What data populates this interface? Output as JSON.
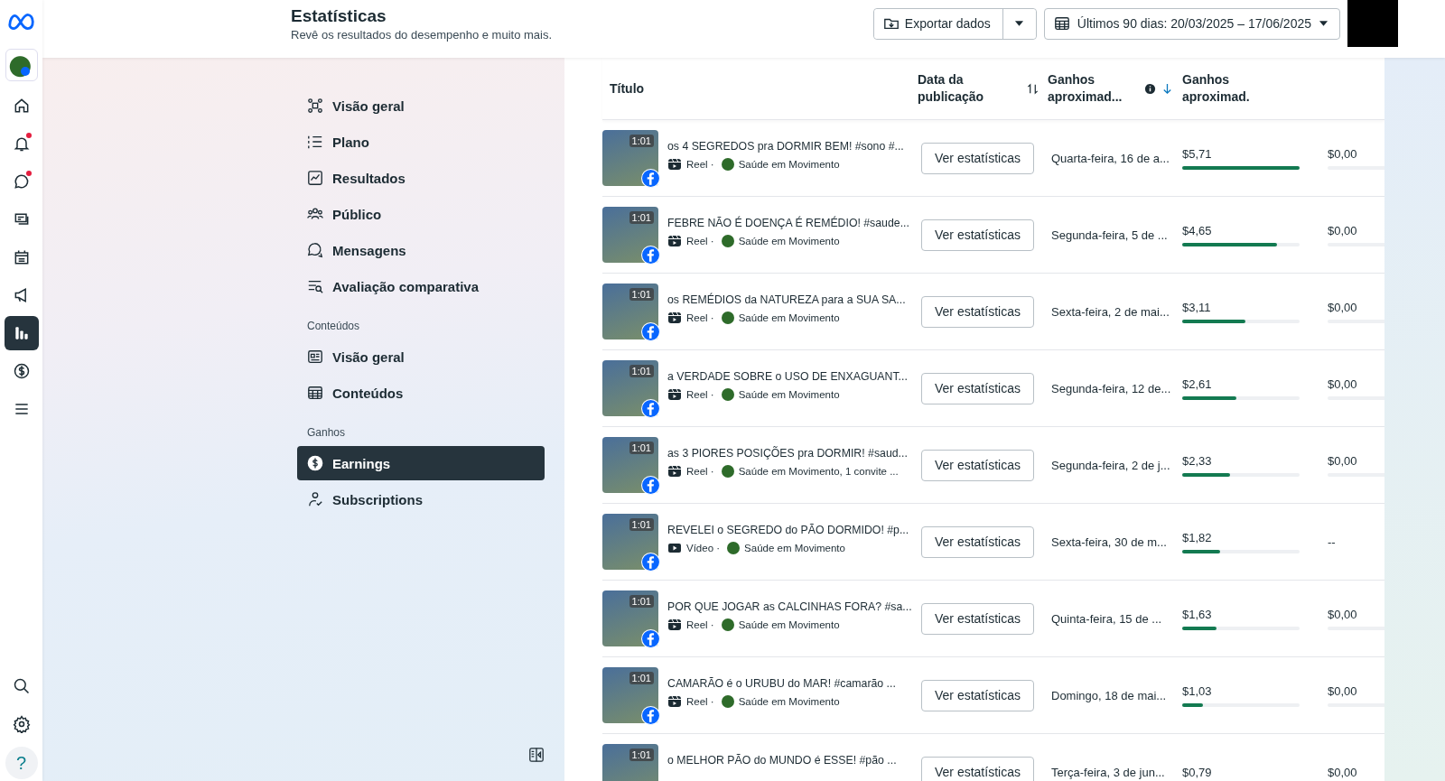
{
  "rail": {
    "top": [
      {
        "kind": "home",
        "selected": false,
        "badge": false
      },
      {
        "kind": "bell",
        "selected": false,
        "badge": true
      },
      {
        "kind": "chat",
        "selected": false,
        "badge": true
      },
      {
        "kind": "feed",
        "selected": false,
        "badge": false
      },
      {
        "kind": "calendar",
        "selected": false,
        "badge": false
      },
      {
        "kind": "megaphone",
        "selected": false,
        "badge": false
      },
      {
        "kind": "chart",
        "selected": true,
        "badge": false
      },
      {
        "kind": "dollar",
        "selected": false,
        "badge": false
      },
      {
        "kind": "menu",
        "selected": false,
        "badge": false
      }
    ],
    "bottom": [
      {
        "kind": "search"
      },
      {
        "kind": "settings"
      }
    ],
    "help": "?"
  },
  "header": {
    "title": "Estatísticas",
    "subtitle": "Revê os resultados do desempenho e muito mais.",
    "export": "Exportar dados",
    "date_range": "Últimos 90 dias: 20/03/2025 – 17/06/2025"
  },
  "nav": {
    "sections": [
      {
        "items": [
          {
            "label": "Visão geral",
            "selected": false
          },
          {
            "label": "Plano",
            "selected": false
          },
          {
            "label": "Resultados",
            "selected": false
          },
          {
            "label": "Público",
            "selected": false
          },
          {
            "label": "Mensagens",
            "selected": false
          },
          {
            "label": "Avaliação comparativa",
            "selected": false
          }
        ]
      },
      {
        "heading": "Conteúdos",
        "items": [
          {
            "label": "Visão geral",
            "selected": false
          },
          {
            "label": "Conteúdos",
            "selected": false
          }
        ]
      },
      {
        "heading": "Ganhos",
        "items": [
          {
            "label": "Earnings",
            "selected": true
          },
          {
            "label": "Subscriptions",
            "selected": false
          }
        ]
      }
    ]
  },
  "table": {
    "columns": [
      "Título",
      "Data da publicação",
      "Ganhos aproximad...",
      "Ganhos aproximad."
    ],
    "rows": [
      {
        "duration": "1:01",
        "title": "os 4 SEGREDOS pra DORMIR BEM! #sono #...",
        "kind": "reel",
        "type": "Reel ·",
        "page": "Saúde em Movimento",
        "button": "Ver estatísticas",
        "date": "Quarta-feira, 16 de a...",
        "earnings": "$5,71",
        "level": 1.0,
        "earnings_2": {
          "value": "$0,00",
          "bar": true
        }
      },
      {
        "duration": "1:01",
        "title": "FEBRE NÃO É DOENÇA É REMÉDIO! #saude...",
        "kind": "reel",
        "type": "Reel ·",
        "page": "Saúde em Movimento",
        "button": "Ver estatísticas",
        "date": "Segunda-feira, 5 de ...",
        "earnings": "$4,65",
        "level": 0.81,
        "earnings_2": {
          "value": "$0,00",
          "bar": true
        }
      },
      {
        "duration": "1:01",
        "title": "os REMÉDIOS da NATUREZA para a SUA SA...",
        "kind": "reel",
        "type": "Reel ·",
        "page": "Saúde em Movimento",
        "button": "Ver estatísticas",
        "date": "Sexta-feira, 2 de mai...",
        "earnings": "$3,11",
        "level": 0.54,
        "earnings_2": {
          "value": "$0,00",
          "bar": true
        }
      },
      {
        "duration": "1:01",
        "title": "a VERDADE SOBRE o USO DE ENXAGUANT...",
        "kind": "reel",
        "type": "Reel ·",
        "page": "Saúde em Movimento",
        "button": "Ver estatísticas",
        "date": "Segunda-feira, 12 de...",
        "earnings": "$2,61",
        "level": 0.46,
        "earnings_2": {
          "value": "$0,00",
          "bar": true
        }
      },
      {
        "duration": "1:01",
        "title": "as 3 PIORES POSIÇÕES pra DORMIR! #saud...",
        "kind": "reel",
        "type": "Reel ·",
        "page": "Saúde em Movimento, 1 convite ...",
        "button": "Ver estatísticas",
        "date": "Segunda-feira, 2 de j...",
        "earnings": "$2,33",
        "level": 0.41,
        "earnings_2": {
          "value": "$0,00",
          "bar": true
        }
      },
      {
        "duration": "1:01",
        "title": "REVELEI o SEGREDO do PÃO DORMIDO! #p...",
        "kind": "video",
        "type": "Vídeo ·",
        "page": "Saúde em Movimento",
        "button": "Ver estatísticas",
        "date": "Sexta-feira, 30 de m...",
        "earnings": "$1,82",
        "level": 0.32,
        "earnings_2": {
          "value": "--",
          "bar": false
        }
      },
      {
        "duration": "1:01",
        "title": "POR QUE JOGAR as CALCINHAS FORA? #sa...",
        "kind": "reel",
        "type": "Reel ·",
        "page": "Saúde em Movimento",
        "button": "Ver estatísticas",
        "date": "Quinta-feira, 15 de ...",
        "earnings": "$1,63",
        "level": 0.29,
        "earnings_2": {
          "value": "$0,00",
          "bar": true
        }
      },
      {
        "duration": "1:01",
        "title": "CAMARÃO é o URUBU do MAR! #camarão ...",
        "kind": "reel",
        "type": "Reel ·",
        "page": "Saúde em Movimento",
        "button": "Ver estatísticas",
        "date": "Domingo, 18 de mai...",
        "earnings": "$1,03",
        "level": 0.18,
        "earnings_2": {
          "value": "$0,00",
          "bar": true
        }
      },
      {
        "duration": "1:01",
        "title": "o MELHOR PÃO do MUNDO é ESSE! #pão ...",
        "button": "Ver estatísticas",
        "date": "Terça-feira, 3 de jun...",
        "earnings": "$0,79",
        "earnings_2": {
          "value": "$0,00"
        }
      }
    ]
  }
}
